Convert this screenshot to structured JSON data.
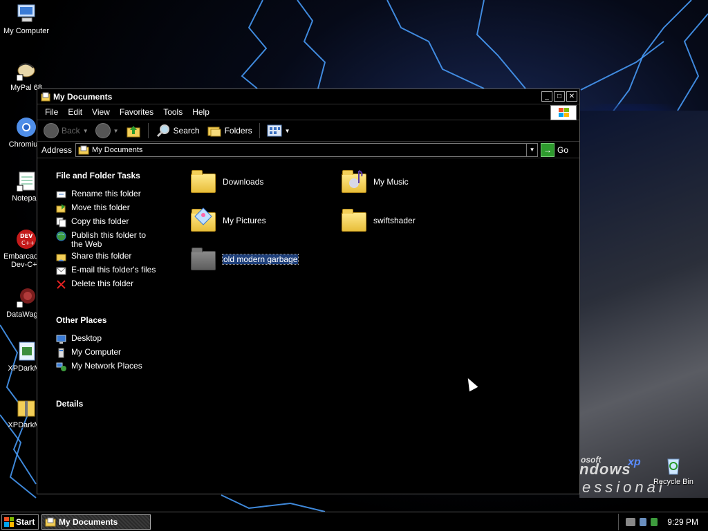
{
  "desktop": {
    "icons": [
      {
        "label": "My Computer"
      },
      {
        "label": "MyPal 68"
      },
      {
        "label": "Chromium"
      },
      {
        "label": "Notepad"
      },
      {
        "label": "Embarcadero Dev-C++"
      },
      {
        "label": "DataWagon"
      },
      {
        "label": "XPDarkMo"
      },
      {
        "label": "XPDarkMo"
      }
    ],
    "recycle_bin": "Recycle Bin",
    "wallpaper_text": {
      "line1": "osoft",
      "line2": "ndows",
      "line3": "xp",
      "line4": "essional"
    }
  },
  "window": {
    "title": "My Documents",
    "menu": [
      "File",
      "Edit",
      "View",
      "Favorites",
      "Tools",
      "Help"
    ],
    "toolbar": {
      "back": "Back",
      "search": "Search",
      "folders": "Folders"
    },
    "address": {
      "label": "Address",
      "value": "My Documents",
      "go": "Go"
    },
    "tasks": {
      "file_folder_title": "File and Folder Tasks",
      "file_folder_items": [
        "Rename this folder",
        "Move this folder",
        "Copy this folder",
        "Publish this folder to the Web",
        "Share this folder",
        "E-mail this folder's files",
        "Delete this folder"
      ],
      "other_places_title": "Other Places",
      "other_places_items": [
        "Desktop",
        "My Computer",
        "My Network Places"
      ],
      "details_title": "Details"
    },
    "files": [
      {
        "name": "Downloads"
      },
      {
        "name": "My Music"
      },
      {
        "name": "My Pictures"
      },
      {
        "name": "swiftshader"
      },
      {
        "name": "old modern garbage",
        "selected": true
      }
    ]
  },
  "taskbar": {
    "start": "Start",
    "active_item": "My Documents",
    "clock": "9:29 PM"
  },
  "colors": {
    "selection": "#1e3f7a",
    "lightning": "#4aa0ff",
    "folder": "#f3cf58"
  }
}
